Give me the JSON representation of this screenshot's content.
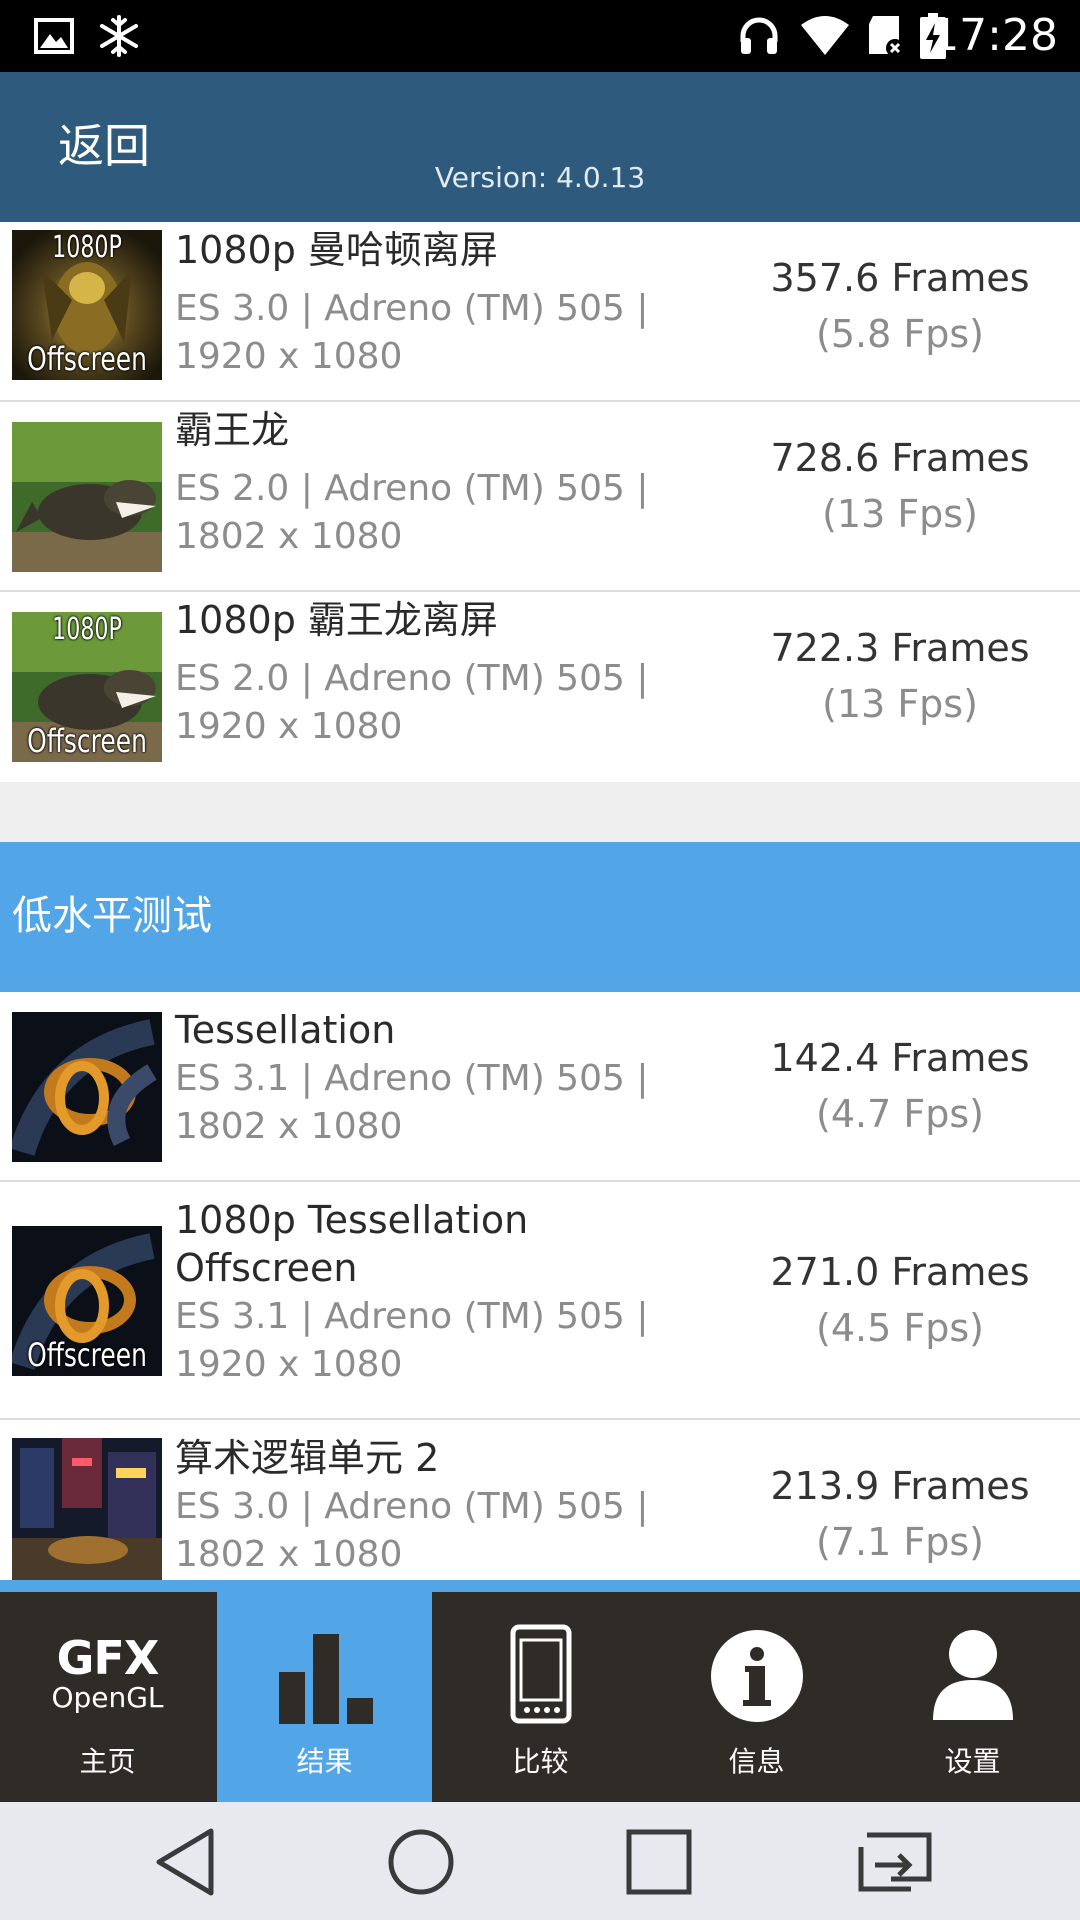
{
  "status_bar": {
    "time": "17:28",
    "icons": [
      "image-icon",
      "snowflake-icon",
      "headset-icon",
      "wifi-icon",
      "sd-card-icon",
      "battery-charging-icon"
    ]
  },
  "header": {
    "back_label": "返回",
    "version": "Version: 4.0.13"
  },
  "tests_top": [
    {
      "title": "1080p 曼哈顿离屏",
      "sub1": "ES 3.0 | Adreno (TM) 505 |",
      "sub2": "1920 x 1080",
      "score": "357.6 Frames",
      "fps": "(5.8 Fps)",
      "thumb_tag_top": "1080P",
      "thumb_tag_bottom": "Offscreen"
    },
    {
      "title": "霸王龙",
      "sub1": "ES 2.0 | Adreno (TM) 505 |",
      "sub2": "1802 x 1080",
      "score": "728.6 Frames",
      "fps": "(13 Fps)"
    },
    {
      "title": "1080p 霸王龙离屏",
      "sub1": "ES 2.0 | Adreno (TM) 505 |",
      "sub2": "1920 x 1080",
      "score": "722.3 Frames",
      "fps": "(13 Fps)",
      "thumb_tag_top": "1080P",
      "thumb_tag_bottom": "Offscreen"
    }
  ],
  "section_low_level": {
    "label": "低水平测试"
  },
  "tests_low": [
    {
      "title": "Tessellation",
      "sub1": "ES 3.1 | Adreno (TM) 505 |",
      "sub2": "1802 x 1080",
      "score": "142.4 Frames",
      "fps": "(4.7 Fps)"
    },
    {
      "title1": "1080p Tessellation",
      "title2": "Offscreen",
      "sub1": "ES 3.1 | Adreno (TM) 505 |",
      "sub2": "1920 x 1080",
      "score": "271.0 Frames",
      "fps": "(4.5 Fps)",
      "thumb_tag_bottom": "Offscreen"
    },
    {
      "title": "算术逻辑单元 2",
      "sub1": "ES 3.0 | Adreno (TM) 505 |",
      "sub2": "1802 x 1080",
      "score": "213.9 Frames",
      "fps": "(7.1 Fps)"
    }
  ],
  "tabs": [
    {
      "label": "主页",
      "logo_line1": "GFX",
      "logo_line2": "OpenGL",
      "active": false
    },
    {
      "label": "结果",
      "active": true
    },
    {
      "label": "比较",
      "active": false
    },
    {
      "label": "信息",
      "active": false
    },
    {
      "label": "设置",
      "active": false
    }
  ],
  "colors": {
    "header": "#2e5a7d",
    "accent": "#52a5e6",
    "tabbar": "#2f2b27",
    "navbar": "#e8e9ee"
  }
}
